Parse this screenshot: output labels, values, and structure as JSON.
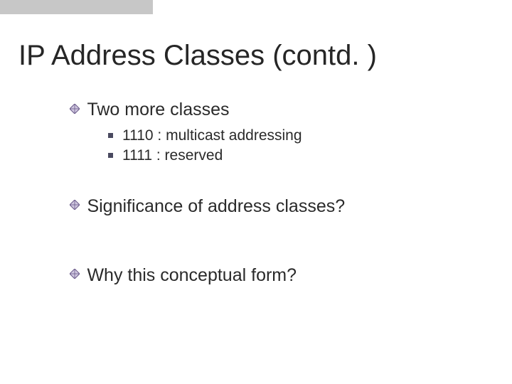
{
  "title": "IP Address Classes (contd. )",
  "bullets": {
    "b1": {
      "text": "Two more classes",
      "sub": {
        "s1": "1110 : multicast addressing",
        "s2": "1111 : reserved"
      }
    },
    "b2": {
      "text": "Significance of address classes?"
    },
    "b3": {
      "text": "Why this conceptual form?"
    }
  },
  "colors": {
    "diamond_border": "#6a5a8a",
    "diamond_fill": "#cfc6df"
  }
}
